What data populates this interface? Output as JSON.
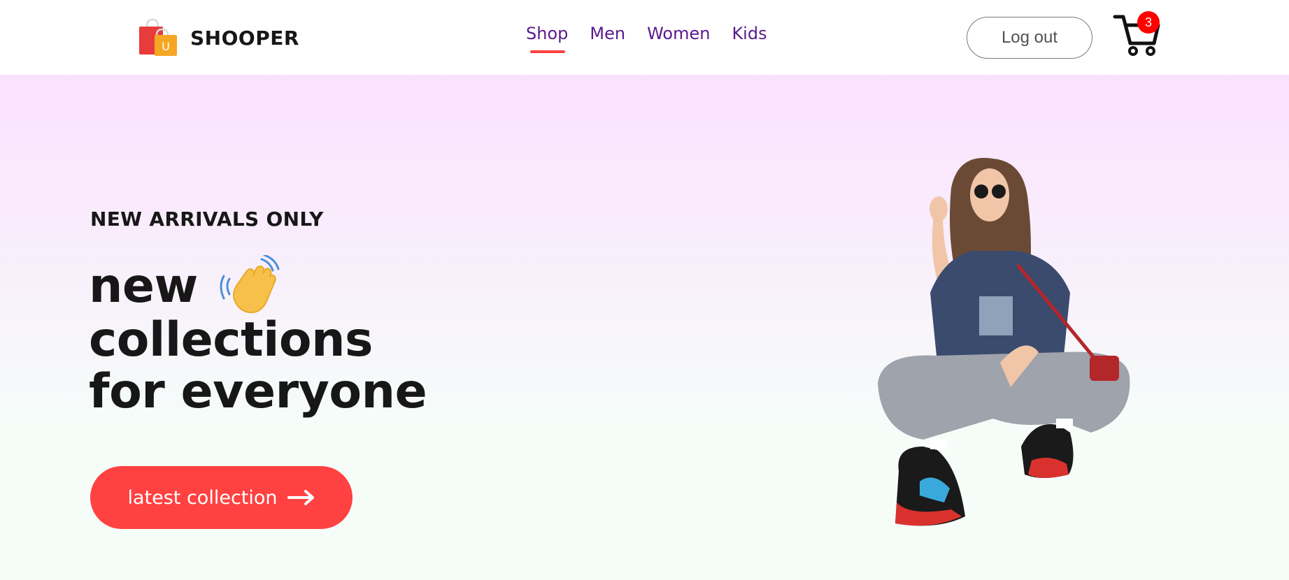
{
  "brand": {
    "name": "SHOOPER",
    "logo_icon": "shopping-bags-icon"
  },
  "nav": {
    "items": [
      {
        "label": "Shop",
        "active": true
      },
      {
        "label": "Men",
        "active": false
      },
      {
        "label": "Women",
        "active": false
      },
      {
        "label": "Kids",
        "active": false
      }
    ]
  },
  "header": {
    "logout_label": "Log out",
    "cart_icon": "cart-icon",
    "cart_count": "3"
  },
  "hero": {
    "kicker": "NEW ARRIVALS ONLY",
    "line1": "new",
    "line2": "collections",
    "line3": "for everyone",
    "hand_icon": "waving-hand-icon",
    "cta_label": "latest collection",
    "cta_icon": "arrow-right-icon",
    "image": "hero-model-photo"
  },
  "colors": {
    "accent": "#ff4141",
    "nav_text": "#5b1a8c",
    "badge": "#ff0000",
    "hero_gradient_top": "#fbe1ff",
    "hero_gradient_bottom": "#f6fdf9"
  }
}
